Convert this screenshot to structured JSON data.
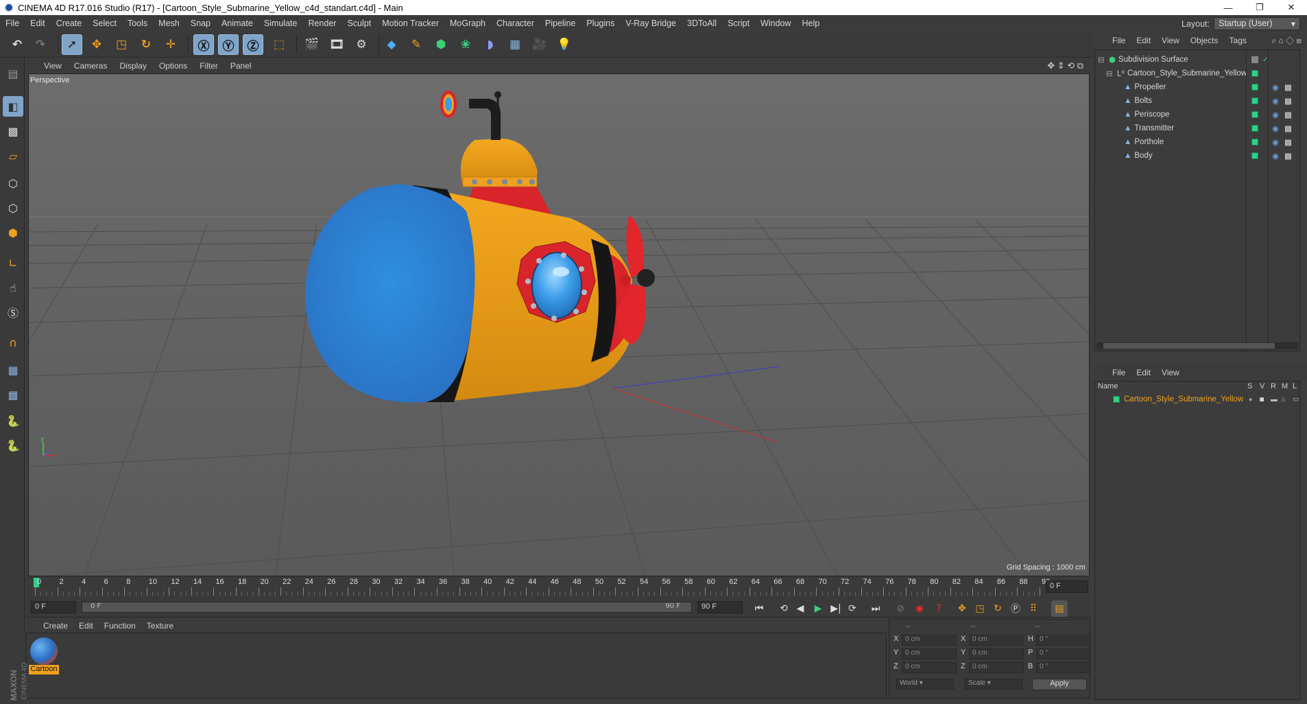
{
  "title_bar": {
    "text": "CINEMA 4D R17.016 Studio (R17) - [Cartoon_Style_Submarine_Yellow_c4d_standart.c4d] - Main",
    "minimize": "—",
    "restore": "❐",
    "close": "✕"
  },
  "menu": [
    "File",
    "Edit",
    "Create",
    "Select",
    "Tools",
    "Mesh",
    "Snap",
    "Animate",
    "Simulate",
    "Render",
    "Sculpt",
    "Motion Tracker",
    "MoGraph",
    "Character",
    "Pipeline",
    "Plugins",
    "V-Ray Bridge",
    "3DToAll",
    "Script",
    "Window",
    "Help"
  ],
  "layout": {
    "label": "Layout:",
    "value": "Startup (User)"
  },
  "viewport_menu": [
    "View",
    "Cameras",
    "Display",
    "Options",
    "Filter",
    "Panel"
  ],
  "viewport": {
    "camera_label": "Perspective",
    "grid_spacing": "Grid Spacing : 1000 cm"
  },
  "timeline": {
    "ticks": [
      "0",
      "2",
      "4",
      "6",
      "8",
      "10",
      "12",
      "14",
      "16",
      "18",
      "20",
      "22",
      "24",
      "26",
      "28",
      "30",
      "32",
      "34",
      "36",
      "38",
      "40",
      "42",
      "44",
      "46",
      "48",
      "50",
      "52",
      "54",
      "56",
      "58",
      "60",
      "62",
      "64",
      "66",
      "68",
      "70",
      "72",
      "74",
      "76",
      "78",
      "80",
      "82",
      "84",
      "86",
      "88",
      "90"
    ],
    "current_frame_right": "0 F",
    "start_field": "0 F",
    "range_start": "0 F",
    "range_end": "90 F",
    "end_field": "90 F"
  },
  "material_menu": [
    "Create",
    "Edit",
    "Function",
    "Texture"
  ],
  "material": {
    "name": "Cartoon"
  },
  "brand": {
    "maxon": "MAXON",
    "c4d": "CINEMA 4D"
  },
  "coords": {
    "headers": [
      "--",
      "--",
      "--"
    ],
    "rows": [
      {
        "a": "X",
        "av": "0 cm",
        "b": "X",
        "bv": "0 cm",
        "c": "H",
        "cv": "0 °"
      },
      {
        "a": "Y",
        "av": "0 cm",
        "b": "Y",
        "bv": "0 cm",
        "c": "P",
        "cv": "0 °"
      },
      {
        "a": "Z",
        "av": "0 cm",
        "b": "Z",
        "bv": "0 cm",
        "c": "B",
        "cv": "0 °"
      }
    ],
    "world": "World",
    "scale": "Scale",
    "apply": "Apply"
  },
  "object_menu": [
    "File",
    "Edit",
    "View",
    "Objects",
    "Tags"
  ],
  "objects": {
    "root": "Subdivision Surface",
    "group": "Cartoon_Style_Submarine_Yellow",
    "children": [
      "Propeller",
      "Bolts",
      "Periscope",
      "Transmitter",
      "Porthole",
      "Body"
    ]
  },
  "attr_menu": [
    "File",
    "Edit",
    "View"
  ],
  "layers": {
    "headers": {
      "name": "Name",
      "s": "S",
      "v": "V",
      "r": "R",
      "m": "M",
      "l": "L"
    },
    "item": "Cartoon_Style_Submarine_Yellow"
  },
  "colors": {
    "accent": "#7fa4c8",
    "object_green": "#2fd08a",
    "highlight_orange": "#f0a020"
  },
  "icons": {
    "toolbar": [
      "undo-icon",
      "redo-icon",
      "select-arrow-icon",
      "move-icon",
      "scale-icon",
      "rotate-icon",
      "live-select-icon",
      "x-axis-icon",
      "y-axis-icon",
      "z-axis-icon",
      "coordinate-system-icon",
      "render-view-icon",
      "render-picture-viewer-icon",
      "render-settings-icon",
      "cube-icon",
      "pen-icon",
      "subdivision-icon",
      "mograph-cloner-icon",
      "deformer-icon",
      "floor-icon",
      "camera-icon",
      "light-icon"
    ]
  }
}
